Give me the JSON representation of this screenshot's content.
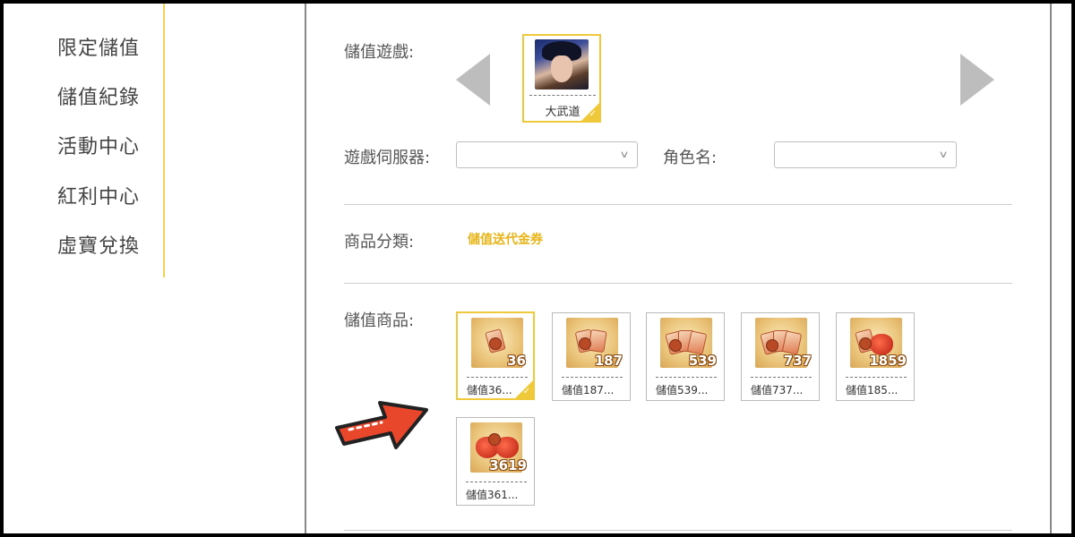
{
  "sidebar": {
    "items": [
      {
        "label": "限定儲值"
      },
      {
        "label": "儲值紀錄"
      },
      {
        "label": "活動中心"
      },
      {
        "label": "紅利中心"
      },
      {
        "label": "虛寶兌換"
      }
    ]
  },
  "form": {
    "game_label": "儲值遊戲:",
    "game": {
      "name": "大武道",
      "selected": true
    },
    "server_label": "遊戲伺服器:",
    "server_value": "",
    "role_label": "角色名:",
    "role_value": "",
    "category_label": "商品分類:",
    "category_value": "儲值送代金券",
    "products_label": "儲值商品:"
  },
  "products": [
    {
      "amount": "36",
      "name": "儲值36...",
      "selected": true
    },
    {
      "amount": "187",
      "name": "儲值187..."
    },
    {
      "amount": "539",
      "name": "儲值539..."
    },
    {
      "amount": "737",
      "name": "儲值737..."
    },
    {
      "amount": "1859",
      "name": "儲值185..."
    },
    {
      "amount": "3619",
      "name": "儲值361..."
    }
  ],
  "colors": {
    "accent": "#f0c93b",
    "category_text": "#e8b418",
    "arrow_red": "#e8472c"
  },
  "icons": {
    "prev": "caret-left-icon",
    "next": "caret-right-icon",
    "check": "check-icon",
    "chevron": "chevron-down-icon",
    "pointer": "red-arrow-icon"
  }
}
